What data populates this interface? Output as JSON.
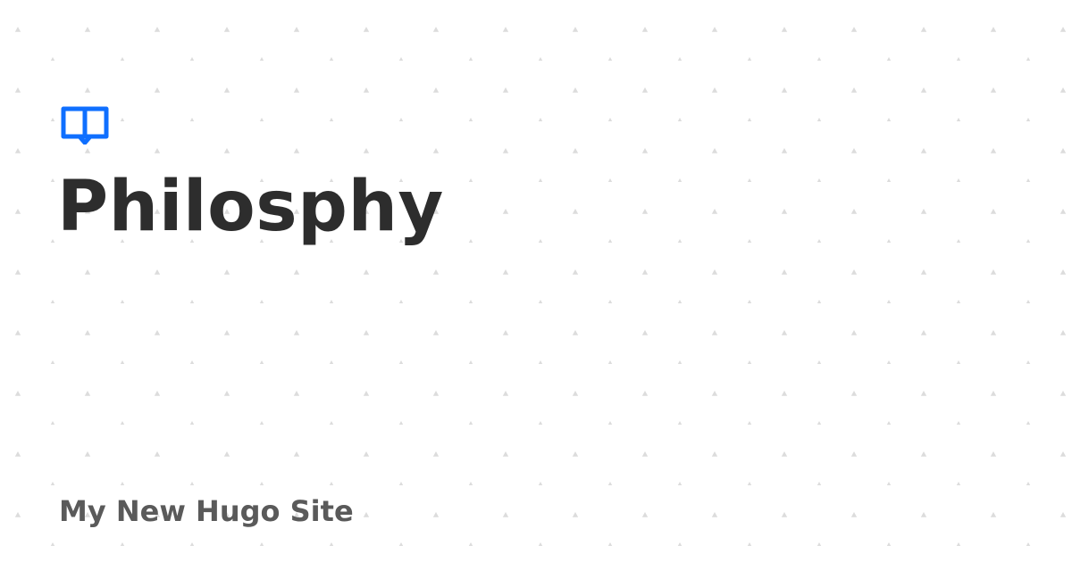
{
  "page": {
    "title": "Philosphy",
    "site_name": "My New Hugo Site"
  },
  "logo": {
    "icon": "open-book-icon"
  },
  "background": {
    "pattern": "dots"
  },
  "colors": {
    "background": "#ffffff",
    "accent": "#0f6fff",
    "title": "#2d2d2d",
    "site_name": "#5a5a5a",
    "pattern": "#dcdcdc"
  }
}
